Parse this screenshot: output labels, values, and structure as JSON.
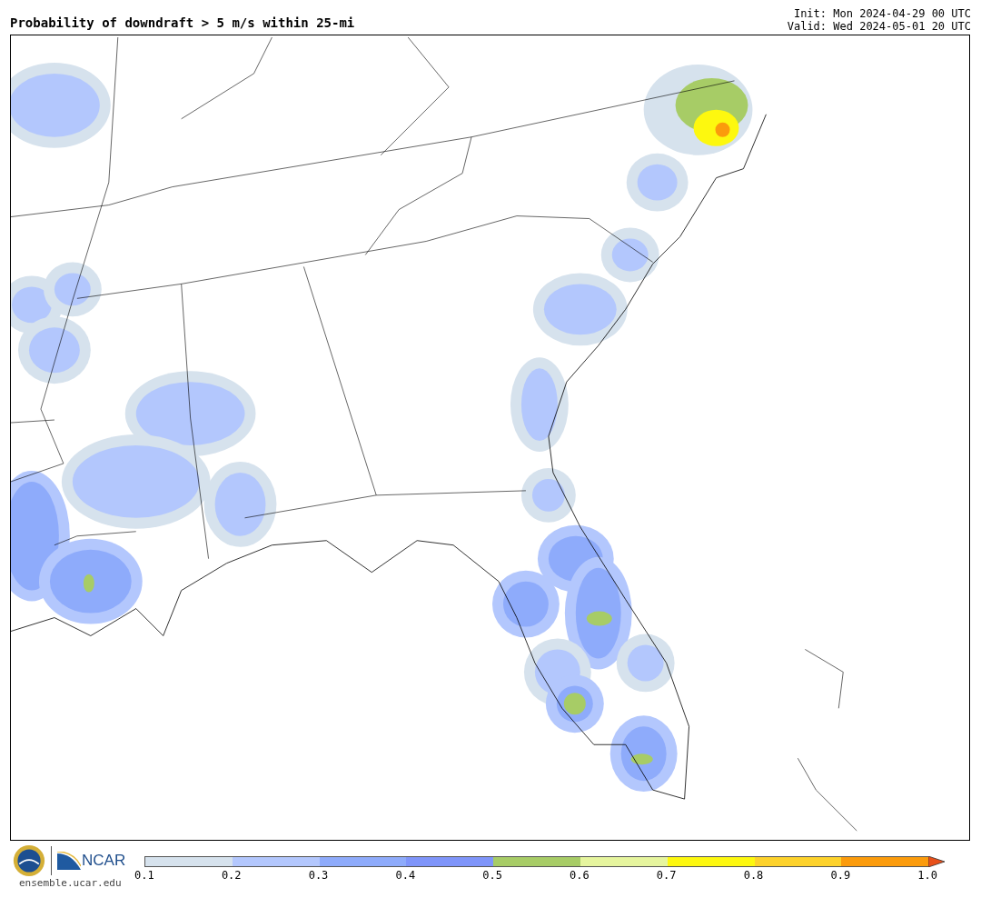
{
  "title": "Probability of downdraft > 5 m/s within 25-mi",
  "init": "Init: Mon 2024-04-29 00 UTC",
  "valid": "Valid: Wed 2024-05-01 20 UTC",
  "footer": {
    "site": "ensemble.ucar.edu",
    "org": "NCAR"
  },
  "colorbar": {
    "bins": [
      {
        "color": "#d6e2ed"
      },
      {
        "color": "#b3c7fd"
      },
      {
        "color": "#8eabfb"
      },
      {
        "color": "#7f95fa"
      },
      {
        "color": "#a7cc66"
      },
      {
        "color": "#e6f59e"
      },
      {
        "color": "#fdf80f"
      },
      {
        "color": "#fdd22b"
      },
      {
        "color": "#fb9b0c"
      },
      {
        "kind": "arrow",
        "color": "#e8501a"
      }
    ],
    "ticks": [
      "0.1",
      "0.2",
      "0.3",
      "0.4",
      "0.5",
      "0.6",
      "0.7",
      "0.8",
      "0.9",
      "1.0"
    ]
  }
}
